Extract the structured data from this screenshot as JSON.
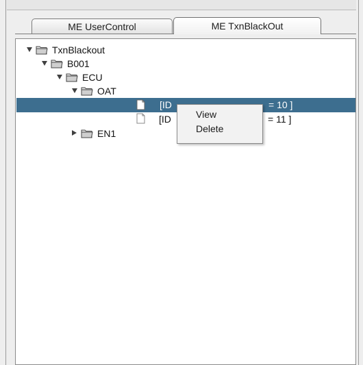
{
  "tabs": [
    {
      "label": "ME UserControl",
      "active": false
    },
    {
      "label": "ME TxnBlackOut",
      "active": true
    }
  ],
  "tree": {
    "root": "TxnBlackout",
    "b001": "B001",
    "ecu": "ECU",
    "oat": "OAT",
    "leaf1_prefix": "[ID",
    "leaf1_suffix": "= 10 ]",
    "leaf2_prefix": "[ID",
    "leaf2_suffix": "= 11 ]",
    "en1": "EN1"
  },
  "context_menu": {
    "items": [
      "View",
      "Delete"
    ]
  },
  "colors": {
    "selection": "#3d6e8f",
    "panel_bg": "#ffffff",
    "window_bg": "#eeeeee"
  },
  "icons": [
    "folder-open-icon",
    "document-icon",
    "expand-triangle-icon",
    "collapse-triangle-icon"
  ]
}
